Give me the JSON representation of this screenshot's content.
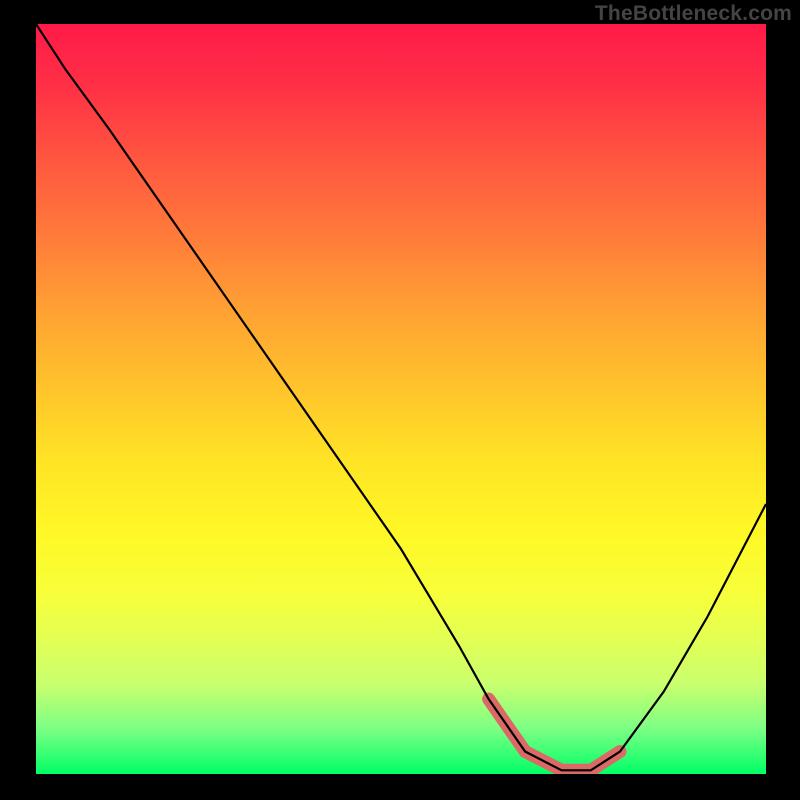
{
  "attribution": "TheBottleneck.com",
  "chart_data": {
    "type": "line",
    "title": "",
    "xlabel": "",
    "ylabel": "",
    "xlim": [
      0,
      100
    ],
    "ylim": [
      0,
      100
    ],
    "series": [
      {
        "name": "bottleneck-curve",
        "x": [
          0,
          4,
          10,
          20,
          30,
          40,
          50,
          58,
          62,
          67,
          72,
          76,
          80,
          86,
          92,
          100
        ],
        "y": [
          100,
          94,
          86,
          72,
          58,
          44,
          30,
          17,
          10,
          3,
          0.5,
          0.5,
          3,
          11,
          21,
          36
        ]
      },
      {
        "name": "highlighted-minimum",
        "x": [
          62,
          67,
          72,
          76,
          80
        ],
        "y": [
          10,
          3,
          0.5,
          0.5,
          3
        ]
      }
    ],
    "annotations": [],
    "grid": false,
    "legend": false,
    "background_gradient": {
      "top": "#ff1a49",
      "mid": "#ffe325",
      "bottom": "#00ff66"
    }
  }
}
